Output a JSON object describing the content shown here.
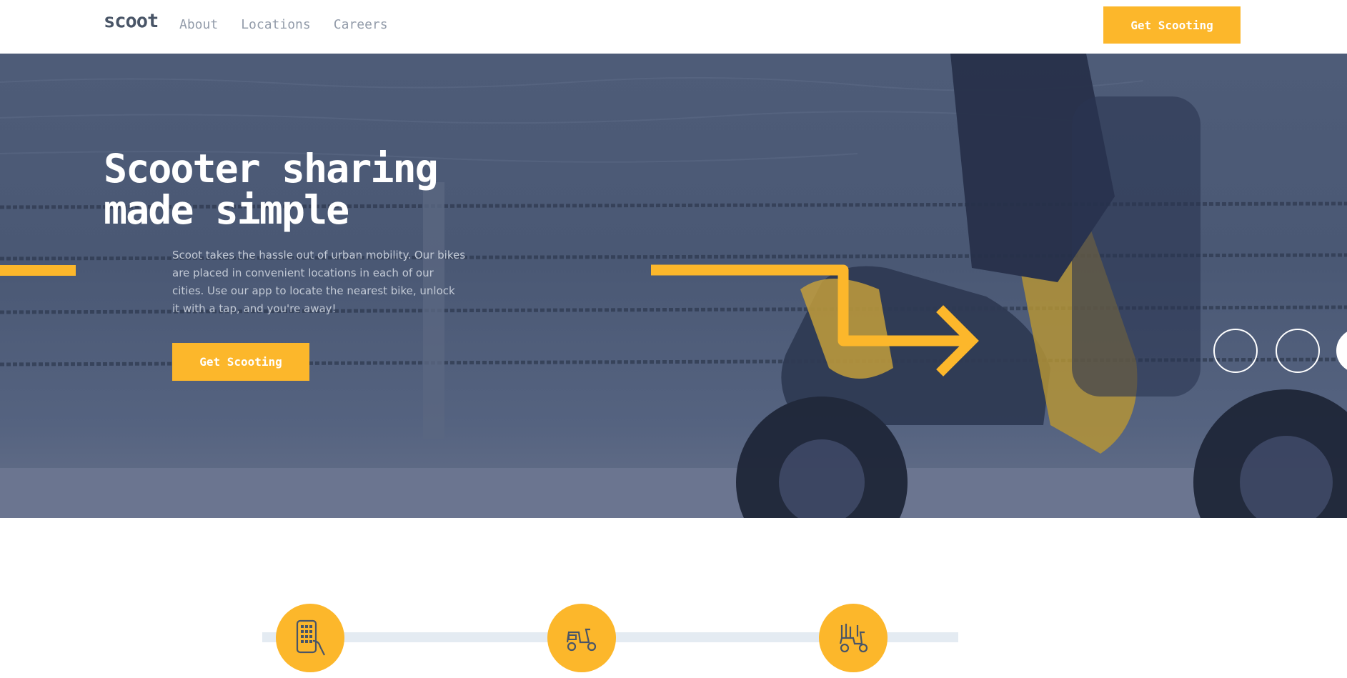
{
  "colors": {
    "accent": "#fcb72b",
    "text_dark": "#495567",
    "nav_text": "#939caa",
    "hero_overlay": "#4a5874"
  },
  "header": {
    "logo": "scoot",
    "nav": [
      {
        "label": "About"
      },
      {
        "label": "Locations"
      },
      {
        "label": "Careers"
      }
    ],
    "cta_label": "Get Scooting"
  },
  "hero": {
    "title": "Scooter sharing made simple",
    "text": "Scoot takes the hassle out of urban mobility. Our bikes are placed in convenient locations in each of our cities. Use our app to locate the nearest bike, unlock it with a tap, and you're away!",
    "cta_label": "Get Scooting"
  },
  "features": {
    "icons": [
      "phone-app-icon",
      "scooter-icon",
      "city-scooter-icon"
    ]
  }
}
